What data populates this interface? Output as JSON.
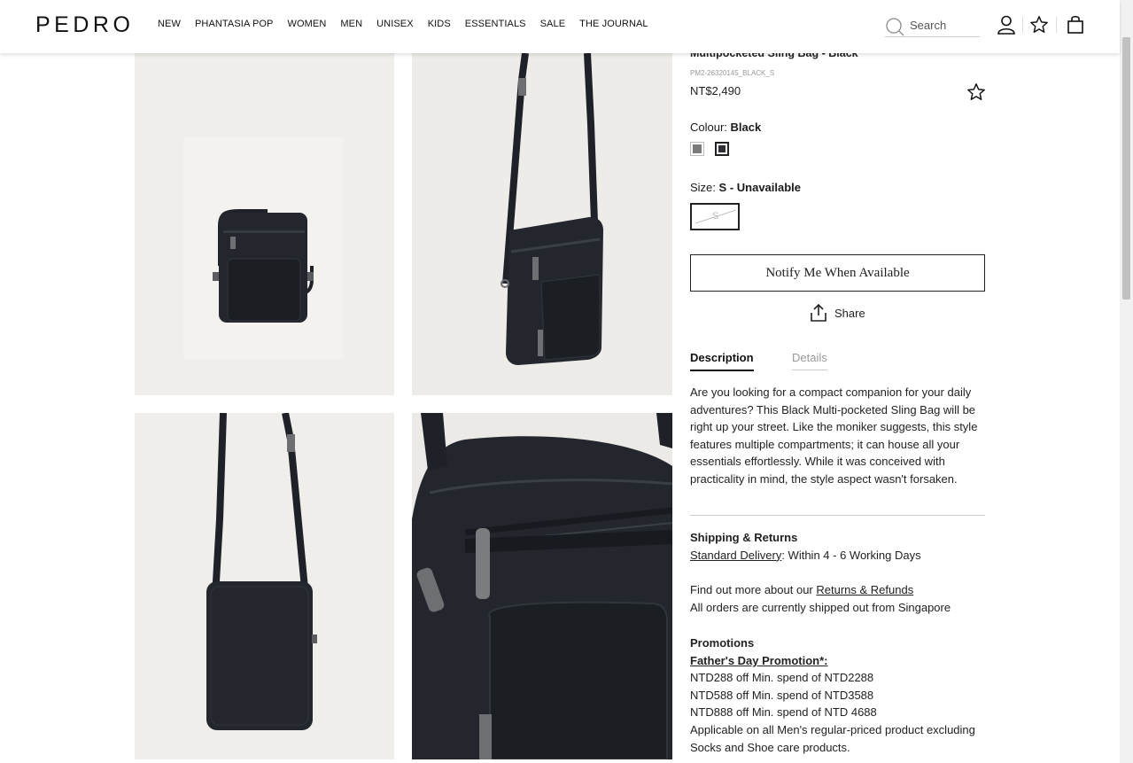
{
  "header": {
    "logo": "PEDRO",
    "nav": [
      "NEW",
      "PHANTASIA POP",
      "WOMEN",
      "MEN",
      "UNISEX",
      "KIDS",
      "ESSENTIALS",
      "SALE",
      "THE JOURNAL"
    ],
    "search_placeholder": "Search"
  },
  "product": {
    "title": "Multipocketed Sling Bag - Black",
    "sku": "PM2-26320145_BLACK_S",
    "price": "NT$2,490",
    "colour_label": "Colour:",
    "colour_value": "Black",
    "swatches": [
      {
        "name": "grey",
        "color": "#7a7a7a",
        "selected": false
      },
      {
        "name": "black",
        "color": "#2b2e33",
        "selected": true
      }
    ],
    "size_label": "Size:",
    "size_value": "S - Unavailable",
    "size_option": "S",
    "notify_label": "Notify Me When Available",
    "share_label": "Share"
  },
  "tabs": {
    "description": "Description",
    "details": "Details"
  },
  "description": "Are you looking for a compact companion for your daily adventures? This Black Multi-pocketed Sling Bag will be right up your street. Like the moniker suggests, this style features multiple compartments; it can house all your essentials effortlessly. While it was conceived with practicality in mind, the style aspect wasn't forsaken.",
  "shipping": {
    "heading": "Shipping & Returns",
    "delivery_link": "Standard Delivery",
    "delivery_text": ": Within 4 - 6 Working Days",
    "returns_prefix": "Find out more about our ",
    "returns_link": "Returns & Refunds",
    "ships_from": "All orders are currently shipped out from Singapore"
  },
  "promotions": {
    "heading": "Promotions",
    "promo_title": "Father's Day Promotion*:",
    "lines": [
      "NTD288 off Min. spend of NTD2288",
      "NTD588 off Min. spend of NTD3588",
      "NTD888 off Min. spend of NTD 4688"
    ],
    "note": "Applicable on all Men's regular-priced product excluding Socks and Shoe care products."
  }
}
